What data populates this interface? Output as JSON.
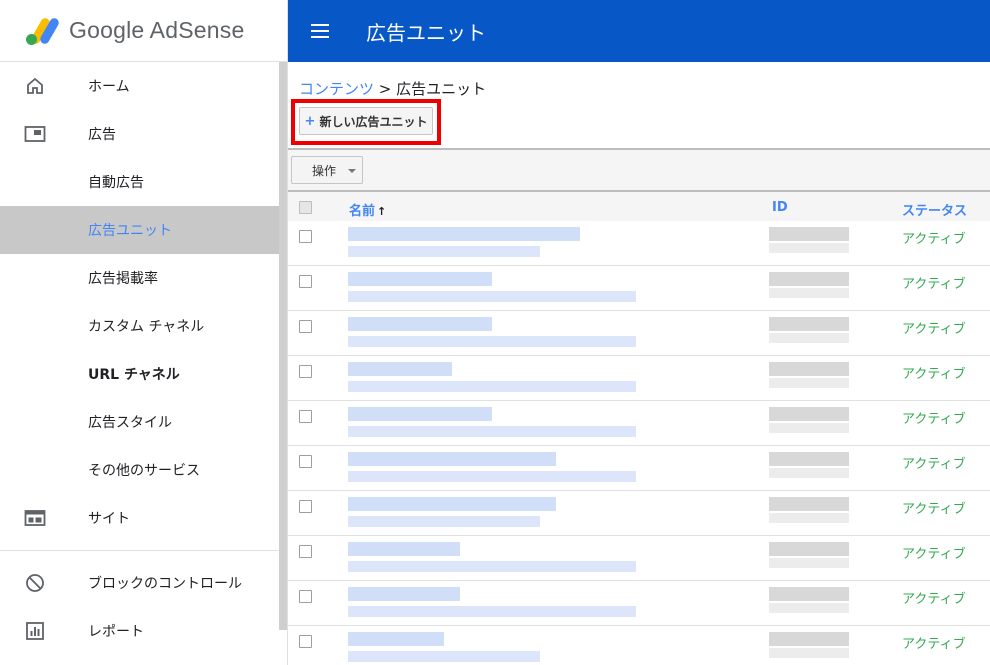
{
  "app": {
    "logo_text": "Google AdSense"
  },
  "header": {
    "title": "広告ユニット"
  },
  "sidebar": {
    "items": [
      {
        "label": "ホーム",
        "icon": "home-icon"
      },
      {
        "label": "広告",
        "icon": "ad-icon"
      },
      {
        "label": "自動広告",
        "icon": ""
      },
      {
        "label": "広告ユニット",
        "icon": "",
        "active": true
      },
      {
        "label": "広告掲載率",
        "icon": ""
      },
      {
        "label": "カスタム チャネル",
        "icon": ""
      },
      {
        "label": "URL チャネル",
        "icon": ""
      },
      {
        "label": "広告スタイル",
        "icon": ""
      },
      {
        "label": "その他のサービス",
        "icon": ""
      },
      {
        "label": "サイト",
        "icon": "sites-icon"
      },
      {
        "label": "ブロックのコントロール",
        "icon": "block-icon"
      },
      {
        "label": "レポート",
        "icon": "report-icon"
      }
    ]
  },
  "breadcrumb": {
    "link": "コンテンツ",
    "separator": ">",
    "current": "広告ユニット"
  },
  "actions": {
    "new_unit": "新しい広告ユニット",
    "new_unit_icon": "plus-icon",
    "operations": "操作"
  },
  "table": {
    "columns": {
      "name": "名前",
      "sort_arrow": "↑",
      "id": "ID",
      "status": "ステータス"
    },
    "rows": [
      {
        "status": "アクティブ"
      },
      {
        "status": "アクティブ"
      },
      {
        "status": "アクティブ"
      },
      {
        "status": "アクティブ"
      },
      {
        "status": "アクティブ"
      },
      {
        "status": "アクティブ"
      },
      {
        "status": "アクティブ"
      },
      {
        "status": "アクティブ"
      },
      {
        "status": "アクティブ"
      },
      {
        "status": "アクティブ"
      }
    ]
  },
  "colors": {
    "header_blue": "#0857c7",
    "link_blue": "#4285f4",
    "active_green": "#34a853",
    "highlight_red": "#e00000"
  }
}
